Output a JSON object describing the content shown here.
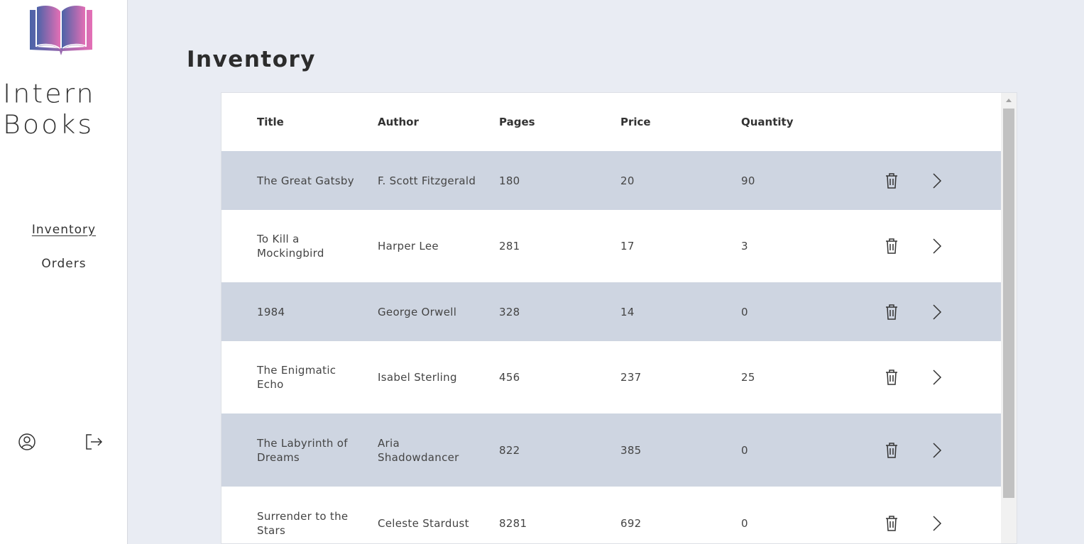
{
  "brand": {
    "line1": "Intern",
    "line2": "Books"
  },
  "nav": {
    "inventory": "Inventory",
    "orders": "Orders"
  },
  "page": {
    "title": "Inventory"
  },
  "table": {
    "columns": [
      "Title",
      "Author",
      "Pages",
      "Price",
      "Quantity"
    ],
    "rows": [
      {
        "title": "The Great Gatsby",
        "author": "F. Scott Fitzgerald",
        "pages": "180",
        "price": "20",
        "quantity": "90"
      },
      {
        "title": "To Kill a Mockingbird",
        "author": "Harper Lee",
        "pages": "281",
        "price": "17",
        "quantity": "3"
      },
      {
        "title": "1984",
        "author": "George Orwell",
        "pages": "328",
        "price": "14",
        "quantity": "0"
      },
      {
        "title": "The Enigmatic Echo",
        "author": "Isabel Sterling",
        "pages": "456",
        "price": "237",
        "quantity": "25"
      },
      {
        "title": "The Labyrinth of Dreams",
        "author": "Aria Shadowdancer",
        "pages": "822",
        "price": "385",
        "quantity": "0"
      },
      {
        "title": "Surrender to the Stars",
        "author": "Celeste Stardust",
        "pages": "8281",
        "price": "692",
        "quantity": "0"
      }
    ]
  },
  "icons": {
    "logo": "open-book-logo",
    "profile": "user-circle-icon",
    "logout": "logout-icon",
    "delete": "trash-icon",
    "open": "chevron-right-icon"
  },
  "colors": {
    "background": "#e9ecf3",
    "row_shaded": "#ced5e1",
    "logo_gradient_start": "#4b63a8",
    "logo_gradient_end": "#e46fb5"
  }
}
